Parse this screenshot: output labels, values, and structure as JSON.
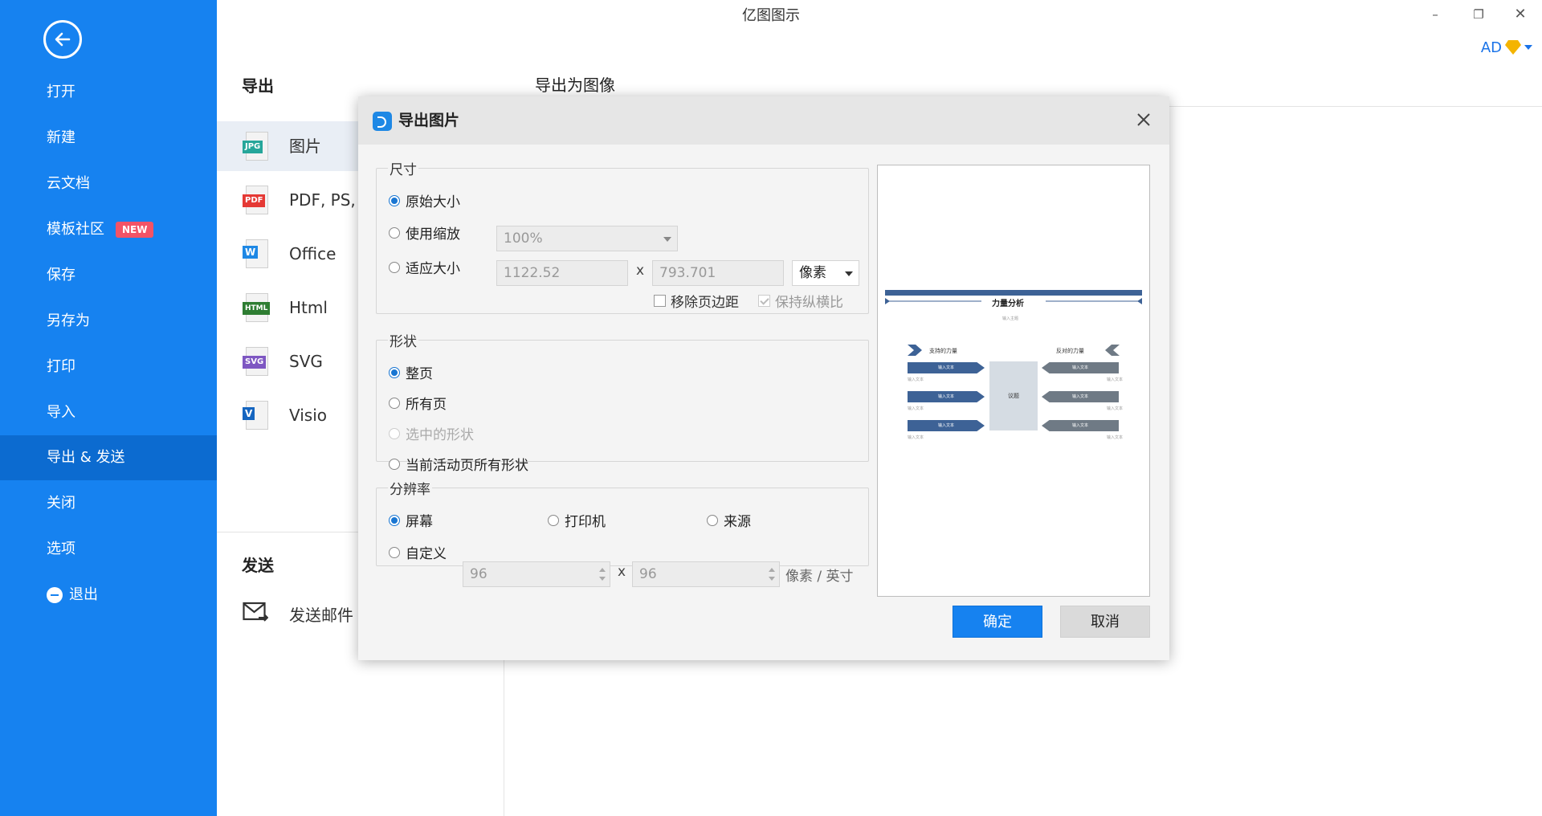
{
  "app": {
    "title": "亿图图示",
    "user": "AD"
  },
  "sidebar": {
    "items": [
      {
        "label": "打开"
      },
      {
        "label": "新建"
      },
      {
        "label": "云文档"
      },
      {
        "label": "模板社区",
        "badge": "NEW"
      },
      {
        "label": "保存"
      },
      {
        "label": "另存为"
      },
      {
        "label": "打印"
      },
      {
        "label": "导入"
      },
      {
        "label": "导出 & 发送",
        "active": true
      },
      {
        "label": "关闭"
      },
      {
        "label": "选项"
      },
      {
        "label": "退出"
      }
    ]
  },
  "export_panel": {
    "heading": "导出",
    "content_heading": "导出为图像",
    "formats": [
      {
        "tag": "JPG",
        "label": "图片",
        "color": "#26a69a"
      },
      {
        "tag": "PDF",
        "label": "PDF, PS,",
        "color": "#e53935"
      },
      {
        "tag": "W",
        "label": "Office",
        "color": "#1e88e5"
      },
      {
        "tag": "HTML",
        "label": "Html",
        "color": "#2e7d32"
      },
      {
        "tag": "SVG",
        "label": "SVG",
        "color": "#7e57c2"
      },
      {
        "tag": "V",
        "label": "Visio",
        "color": "#1565c0"
      }
    ],
    "send_heading": "发送",
    "send_email": "发送邮件"
  },
  "dialog": {
    "title": "导出图片",
    "size": {
      "legend": "尺寸",
      "original": "原始大小",
      "use_scale": "使用缩放",
      "scale_value": "100%",
      "fit_size": "适应大小",
      "width": "1122.52",
      "times": "x",
      "height": "793.701",
      "unit": "像素",
      "remove_margin": "移除页边距",
      "keep_ratio": "保持纵横比"
    },
    "shape": {
      "legend": "形状",
      "whole_page": "整页",
      "all_pages": "所有页",
      "selected_shapes": "选中的形状",
      "active_page_shapes": "当前活动页所有形状"
    },
    "resolution": {
      "legend": "分辨率",
      "screen": "屏幕",
      "printer": "打印机",
      "source": "来源",
      "custom": "自定义",
      "dpi_x": "96",
      "times": "x",
      "dpi_y": "96",
      "unit": "像素 / 英寸"
    },
    "preview": {
      "title": "力量分析",
      "subtitle": "输入主题",
      "left_label": "支持的力量",
      "right_label": "反对的力量",
      "center": "议题",
      "item": "输入文本",
      "note": "输入文本"
    },
    "ok": "确定",
    "cancel": "取消"
  }
}
